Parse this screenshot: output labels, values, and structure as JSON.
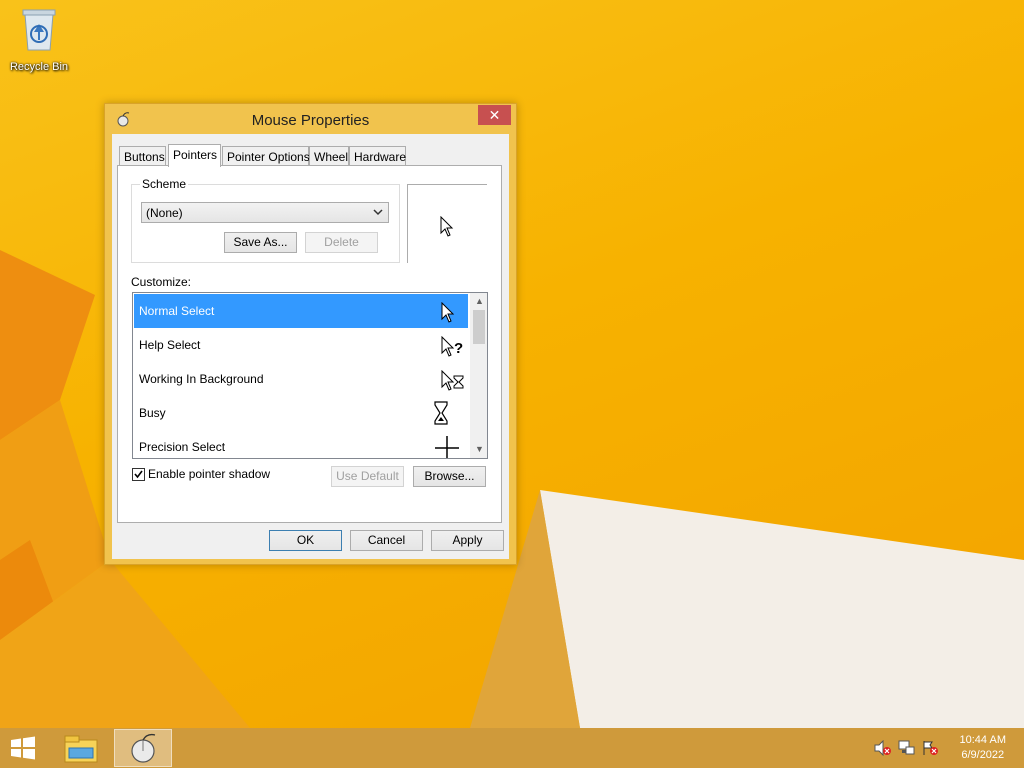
{
  "desktop": {
    "icons": [
      {
        "label": "Recycle Bin",
        "icon": "recycle-bin-icon"
      }
    ]
  },
  "window": {
    "title": "Mouse Properties",
    "close_label": "✕",
    "tabs": [
      {
        "label": "Buttons",
        "active": false
      },
      {
        "label": "Pointers",
        "active": true
      },
      {
        "label": "Pointer Options",
        "active": false
      },
      {
        "label": "Wheel",
        "active": false
      },
      {
        "label": "Hardware",
        "active": false
      }
    ],
    "scheme": {
      "group_label": "Scheme",
      "selected": "(None)",
      "save_as_label": "Save As...",
      "delete_label": "Delete"
    },
    "customize_label": "Customize:",
    "pointers": [
      {
        "label": "Normal Select",
        "icon": "arrow-cursor-icon",
        "selected": true
      },
      {
        "label": "Help Select",
        "icon": "help-cursor-icon",
        "selected": false
      },
      {
        "label": "Working In Background",
        "icon": "working-cursor-icon",
        "selected": false
      },
      {
        "label": "Busy",
        "icon": "hourglass-cursor-icon",
        "selected": false
      },
      {
        "label": "Precision Select",
        "icon": "crosshair-cursor-icon",
        "selected": false
      }
    ],
    "shadow": {
      "label": "Enable pointer shadow",
      "checked": true
    },
    "use_default_label": "Use Default",
    "browse_label": "Browse...",
    "ok_label": "OK",
    "cancel_label": "Cancel",
    "apply_label": "Apply"
  },
  "taskbar": {
    "items": [
      {
        "icon": "start-icon"
      },
      {
        "icon": "file-explorer-icon"
      },
      {
        "icon": "mouse-properties-icon",
        "active": true
      }
    ],
    "tray": [
      {
        "icon": "speaker-muted-icon"
      },
      {
        "icon": "network-icon"
      },
      {
        "icon": "action-center-icon"
      }
    ],
    "time": "10:44 AM",
    "date": "6/9/2022"
  },
  "colors": {
    "wallpaper": "#f7b200",
    "titlebar": "#f1c34d",
    "close": "#c75050",
    "selection": "#3399ff",
    "taskbar": "#cf9a3b"
  }
}
